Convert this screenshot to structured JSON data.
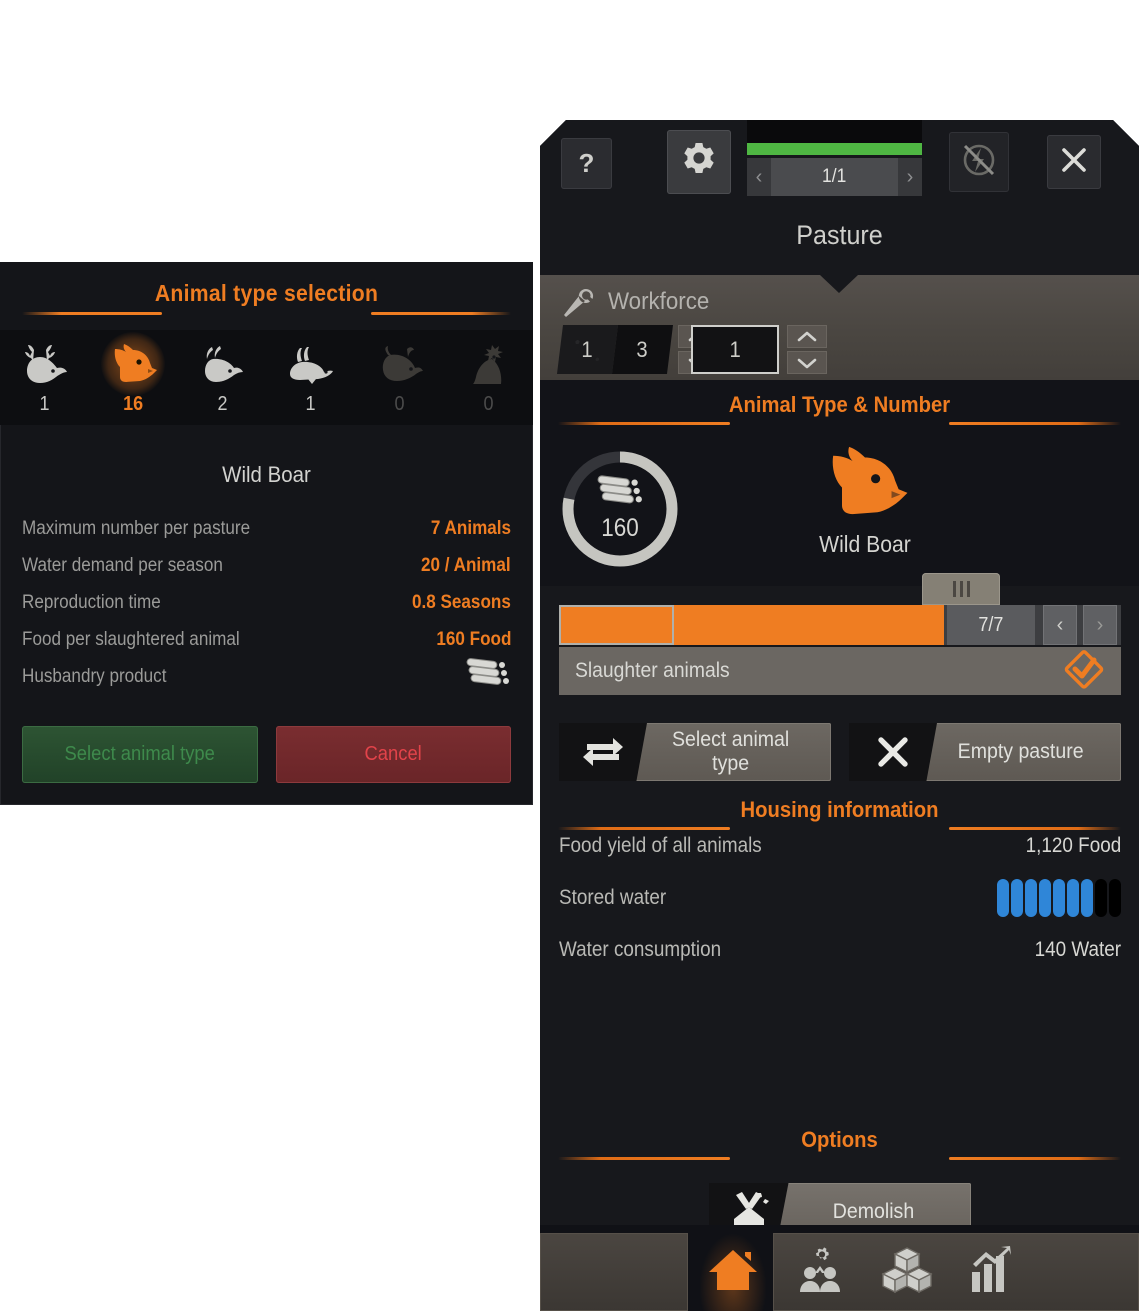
{
  "left_panel": {
    "title": "Animal type selection",
    "animals": [
      {
        "name": "deer",
        "icon": "deer-icon",
        "count": "1",
        "state": "normal"
      },
      {
        "name": "wild-boar",
        "icon": "boar-icon",
        "count": "16",
        "state": "selected"
      },
      {
        "name": "goat",
        "icon": "goat-icon",
        "count": "2",
        "state": "normal"
      },
      {
        "name": "rabbit",
        "icon": "rabbit-icon",
        "count": "1",
        "state": "normal"
      },
      {
        "name": "cattle",
        "icon": "cattle-icon",
        "count": "0",
        "state": "disabled"
      },
      {
        "name": "chicken",
        "icon": "chicken-icon",
        "count": "0",
        "state": "disabled"
      }
    ],
    "selected_animal": "Wild Boar",
    "stats": [
      {
        "label": "Maximum number per pasture",
        "value": "7 Animals"
      },
      {
        "label": "Water demand per season",
        "value": "20 / Animal"
      },
      {
        "label": "Reproduction time",
        "value": "0.8 Seasons"
      },
      {
        "label": "Food per slaughtered animal",
        "value": "160 Food"
      },
      {
        "label": "Husbandry product",
        "value": "",
        "icon": "husbandry-product-icon"
      }
    ],
    "confirm_label": "Select animal type",
    "cancel_label": "Cancel"
  },
  "right_panel": {
    "header": {
      "help_label": "?",
      "gear_icon": "gear-icon",
      "power_icon": "disable-production-icon",
      "close_icon": "close-icon",
      "thumbnail_icon": "pasture-building-icon",
      "nav_prev": "‹",
      "nav_value": "1/1",
      "nav_next": "›",
      "health_percent": 100
    },
    "building_title": "Pasture",
    "workforce": {
      "title": "Workforce",
      "icon": "wrench-icon",
      "group1": {
        "tile_a": "1",
        "tile_b": "3"
      },
      "group2": {
        "tile": "1"
      }
    },
    "section_animal": "Animal Type & Number",
    "animal": {
      "gauge_value": "160",
      "gauge_percent": 78,
      "product_icon": "husbandry-product-icon",
      "animal_icon": "boar-icon",
      "animal_name": "Wild Boar"
    },
    "slider": {
      "ratio": "7/7",
      "fill_percent": 100,
      "prev": "‹",
      "next": "›",
      "handle_icon": "slider-handle-icon"
    },
    "slaughter": {
      "label": "Slaughter animals",
      "checked": true,
      "check_icon": "check-diamond-icon"
    },
    "actions": [
      {
        "label": "Select animal type",
        "icon": "swap-arrows-icon"
      },
      {
        "label": "Empty pasture",
        "icon": "x-mark-icon"
      }
    ],
    "section_housing": "Housing information",
    "housing": [
      {
        "label": "Food yield of all animals",
        "value": "1,120 Food"
      },
      {
        "label": "Stored water",
        "value": "",
        "pills_total": 9,
        "pills_filled": 7
      },
      {
        "label": "Water consumption",
        "value": "140 Water"
      }
    ],
    "section_options": "Options",
    "demolish": {
      "label": "Demolish",
      "icon": "demolish-icon"
    },
    "tabs": [
      {
        "name": "tab-home",
        "icon": "home-icon",
        "active": true
      },
      {
        "name": "tab-people",
        "icon": "people-gear-icon",
        "active": false
      },
      {
        "name": "tab-resources",
        "icon": "boxes-icon",
        "active": false
      },
      {
        "name": "tab-stats",
        "icon": "chart-icon",
        "active": false
      }
    ]
  },
  "colors": {
    "accent": "#ef7d22",
    "panel_bg": "#17181c",
    "text": "#cfcfcb",
    "water": "#2f86d8",
    "health": "#4fb743"
  }
}
